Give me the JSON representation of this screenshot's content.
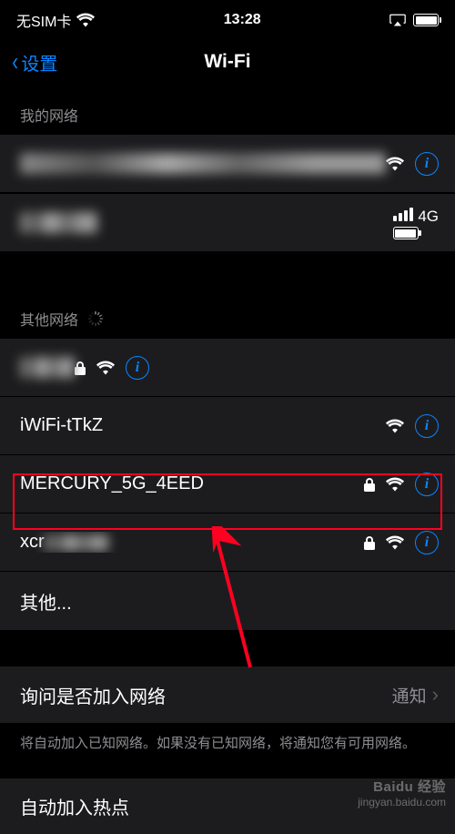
{
  "status": {
    "carrier": "无SIM卡",
    "time": "13:28"
  },
  "nav": {
    "back": "设置",
    "title": "Wi-Fi"
  },
  "sections": {
    "my_label": "我的网络",
    "other_label": "其他网络"
  },
  "my_networks": [
    {
      "name": "████████████████",
      "censored": true,
      "lock": false,
      "wifi": true,
      "info": true
    },
    {
      "name": "██████",
      "censored": true,
      "cellular": true,
      "cell_label": "4G"
    }
  ],
  "other_networks": [
    {
      "name": "██",
      "censored": true,
      "lock": true,
      "wifi": true,
      "info": true
    },
    {
      "name": "iWiFi-tTkZ",
      "lock": false,
      "wifi": true,
      "info": true
    },
    {
      "name": "MERCURY_5G_4EED",
      "lock": true,
      "wifi": true,
      "info": true
    },
    {
      "name_prefix": "xcr",
      "name_suffix": "███",
      "censored_suffix": true,
      "lock": true,
      "wifi": true,
      "info": true,
      "highlighted": true
    }
  ],
  "other_row": "其他...",
  "ask_to_join": {
    "label": "询问是否加入网络",
    "value": "通知"
  },
  "ask_note": "将自动加入已知网络。如果没有已知网络，将通知您有可用网络。",
  "auto_hotspot": {
    "label": "自动加入热点"
  },
  "watermark": {
    "brand": "Baidu 经验",
    "url": "jingyan.baidu.com"
  }
}
